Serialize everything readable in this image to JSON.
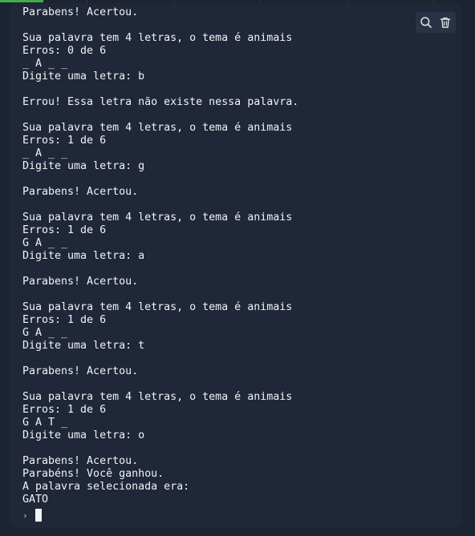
{
  "console": {
    "lines": [
      "Parabens! Acertou.",
      "",
      "Sua palavra tem 4 letras, o tema é animais",
      "Erros: 0 de 6",
      "_ A _ _",
      "Digite uma letra: b",
      "",
      "Errou! Essa letra não existe nessa palavra.",
      "",
      "Sua palavra tem 4 letras, o tema é animais",
      "Erros: 1 de 6",
      "_ A _ _",
      "Digite uma letra: g",
      "",
      "Parabens! Acertou.",
      "",
      "Sua palavra tem 4 letras, o tema é animais",
      "Erros: 1 de 6",
      "G A _ _",
      "Digite uma letra: a",
      "",
      "Parabens! Acertou.",
      "",
      "Sua palavra tem 4 letras, o tema é animais",
      "Erros: 1 de 6",
      "G A _ _",
      "Digite uma letra: t",
      "",
      "Parabens! Acertou.",
      "",
      "Sua palavra tem 4 letras, o tema é animais",
      "Erros: 1 de 6",
      "G A T _",
      "Digite uma letra: o",
      "",
      "Parabens! Acertou.",
      "Parabéns! Você ganhou.",
      "A palavra selecionada era:",
      "GATO"
    ],
    "prompt_symbol": "›"
  },
  "toolbar": {
    "search_icon": "search-icon",
    "clear_icon": "trash-icon"
  },
  "colors": {
    "background": "#1c2331",
    "console_bg": "#1f2738",
    "text": "#f1f3f6",
    "prompt": "#d6d45c",
    "accent": "#3fae49"
  }
}
